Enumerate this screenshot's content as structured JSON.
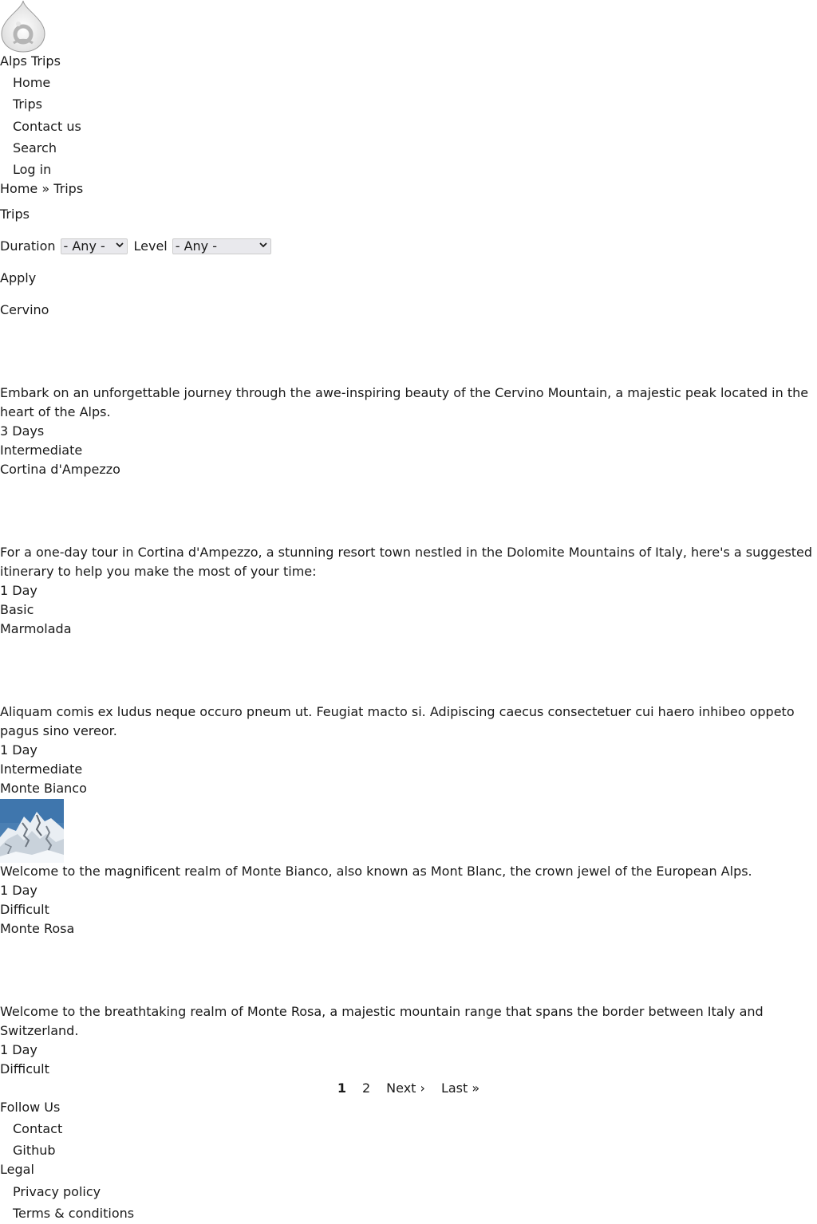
{
  "site": {
    "name": "Alps Trips"
  },
  "nav": {
    "items": [
      {
        "label": "Home"
      },
      {
        "label": "Trips"
      },
      {
        "label": "Contact us"
      },
      {
        "label": "Search"
      },
      {
        "label": "Log in"
      }
    ]
  },
  "breadcrumb": {
    "home": "Home",
    "separator": "»",
    "current": "Trips"
  },
  "page": {
    "title": "Trips"
  },
  "filters": {
    "duration_label": "Duration",
    "duration_value": "- Any -",
    "level_label": "Level",
    "level_value": "- Any -",
    "apply_label": "Apply"
  },
  "trips": [
    {
      "title": "Cervino",
      "description": "Embark on an unforgettable journey through the awe-inspiring beauty of the Cervino Mountain, a majestic peak located in the heart of the Alps.",
      "duration": "3 Days",
      "level": "Intermediate"
    },
    {
      "title": "Cortina d'Ampezzo",
      "description": "For a one-day tour in Cortina d'Ampezzo, a stunning resort town nestled in the Dolomite Mountains of Italy, here's a suggested itinerary to help you make the most of your time:",
      "duration": "1 Day",
      "level": "Basic"
    },
    {
      "title": "Marmolada",
      "description": "Aliquam comis ex ludus neque occuro pneum ut. Feugiat macto si. Adipiscing caecus consectetuer cui haero inhibeo oppeto pagus sino vereor.",
      "duration": "1 Day",
      "level": "Intermediate"
    },
    {
      "title": "Monte Bianco",
      "description": "Welcome to the magnificent realm of Monte Bianco, also known as Mont Blanc, the crown jewel of the European Alps.",
      "duration": "1 Day",
      "level": "Difficult"
    },
    {
      "title": "Monte Rosa",
      "description": "Welcome to the breathtaking realm of Monte Rosa, a majestic mountain range that spans the border between Italy and Switzerland.",
      "duration": "1 Day",
      "level": "Difficult"
    }
  ],
  "pager": {
    "current": "1",
    "page2": "2",
    "next": "Next ›",
    "last": "Last »"
  },
  "footer": {
    "follow_heading": "Follow Us",
    "follow_links": [
      {
        "label": "Contact"
      },
      {
        "label": "Github"
      }
    ],
    "legal_heading": "Legal",
    "legal_links": [
      {
        "label": "Privacy policy"
      },
      {
        "label": "Terms & conditions"
      }
    ]
  }
}
